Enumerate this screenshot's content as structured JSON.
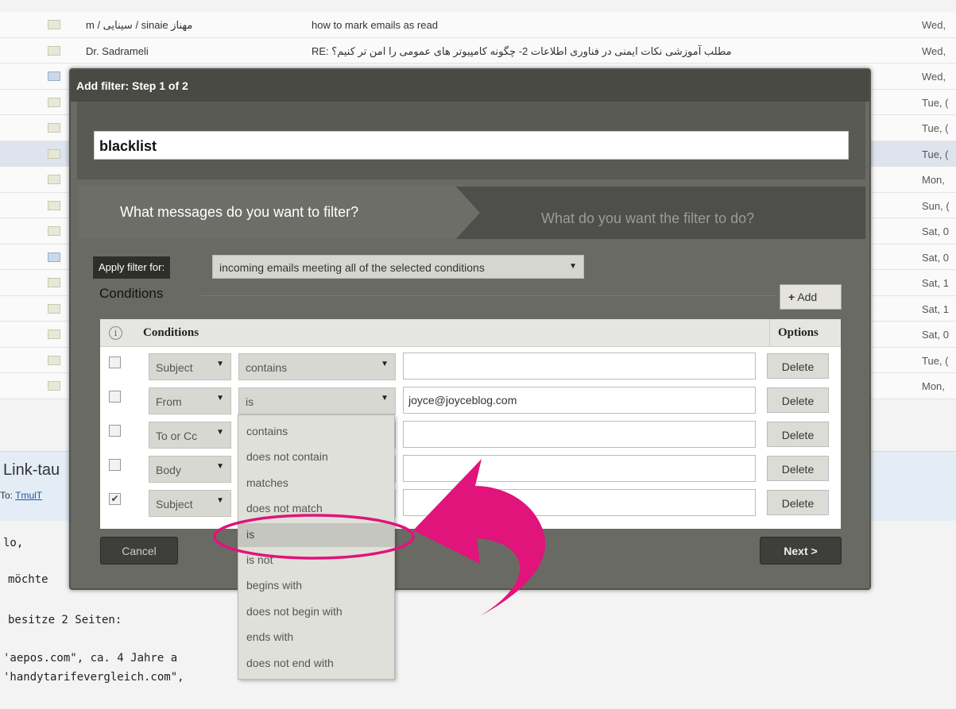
{
  "emails": [
    {
      "sender": "m / سینایی / sinaie مهناز",
      "subject": "how to mark emails as read",
      "date": "Wed,",
      "icon": "envelope-icon",
      "selected": false
    },
    {
      "sender": "Dr. Sadrameli",
      "subject": "RE: مطلب آموزشی نکات ایمنی در فناوری اطلاعات 2- چگونه کامپیوتر های عمومی را امن تر کنیم؟",
      "date": "Wed,",
      "icon": "envelope-icon",
      "selected": false
    },
    {
      "sender": "",
      "subject": "",
      "date": "Wed,",
      "icon": "reply-icon",
      "selected": false
    },
    {
      "sender": "",
      "subject": "",
      "date": "Tue, (",
      "icon": "envelope-icon",
      "selected": false
    },
    {
      "sender": "",
      "subject": "",
      "date": "Tue, (",
      "icon": "envelope-icon",
      "selected": false
    },
    {
      "sender": "",
      "subject": "",
      "date": "Tue, (",
      "icon": "envelope-icon",
      "selected": true
    },
    {
      "sender": "",
      "subject": "",
      "date": "Mon,",
      "icon": "envelope-icon",
      "selected": false
    },
    {
      "sender": "",
      "subject": "",
      "date": "Sun, (",
      "icon": "envelope-icon",
      "selected": false
    },
    {
      "sender": "",
      "subject": "",
      "date": "Sat, 0",
      "icon": "envelope-icon",
      "selected": false
    },
    {
      "sender": "",
      "subject": "",
      "date": "Sat, 0",
      "icon": "reply-icon",
      "selected": false
    },
    {
      "sender": "",
      "subject": "",
      "date": "Sat, 1",
      "icon": "envelope-icon",
      "selected": false
    },
    {
      "sender": "",
      "subject": "",
      "date": "Sat, 1",
      "icon": "envelope-icon",
      "selected": false
    },
    {
      "sender": "",
      "subject": "",
      "date": "Sat, 0",
      "icon": "envelope-icon",
      "selected": false
    },
    {
      "sender": "",
      "subject": "",
      "date": "Tue, (",
      "icon": "envelope-icon",
      "selected": false
    },
    {
      "sender": "",
      "subject": "",
      "date": "Mon,",
      "icon": "envelope-icon",
      "selected": false
    }
  ],
  "preview": {
    "title": "Link-tau",
    "to_label": "To:",
    "to_link": "TmulT",
    "body_lines": [
      "lo,",
      "möchte",
      "besitze 2 Seiten:",
      "'aepos.com\", ca. 4 Jahre a",
      "'handytarifevergleich.com\", "
    ]
  },
  "dialog": {
    "title": "Add filter: Step 1 of 2",
    "filter_name": "blacklist",
    "tab_active": "What messages do you want to filter?",
    "tab_inactive": "What do you want the filter to do?",
    "apply_label": "Apply filter for:",
    "apply_value": "incoming emails meeting all of the selected conditions",
    "conditions_heading": "Conditions",
    "add_label": "Add",
    "table_header_conditions": "Conditions",
    "table_header_options": "Options",
    "info_icon_glyph": "i",
    "cancel_label": "Cancel",
    "next_label": "Next >",
    "rows": [
      {
        "checked": false,
        "field": "Subject",
        "operator": "contains",
        "value": "",
        "delete_label": "Delete"
      },
      {
        "checked": false,
        "field": "From",
        "operator": "is",
        "value": "joyce@joyceblog.com",
        "delete_label": "Delete"
      },
      {
        "checked": false,
        "field": "To or Cc",
        "operator": "",
        "value": "",
        "delete_label": "Delete"
      },
      {
        "checked": false,
        "field": "Body",
        "operator": "",
        "value": "",
        "delete_label": "Delete"
      },
      {
        "checked": true,
        "field": "Subject",
        "operator": "",
        "value": "",
        "delete_label": "Delete"
      }
    ]
  },
  "operator_dropdown": {
    "options": [
      "contains",
      "does not contain",
      "matches",
      "does not match",
      "is",
      "is not",
      "begins with",
      "does not begin with",
      "ends with",
      "does not end with"
    ],
    "highlighted_index": 4
  },
  "colors": {
    "annotation": "#e0147a",
    "dialog_bg": "#6a6a64",
    "title_bar": "#4a4a45"
  }
}
